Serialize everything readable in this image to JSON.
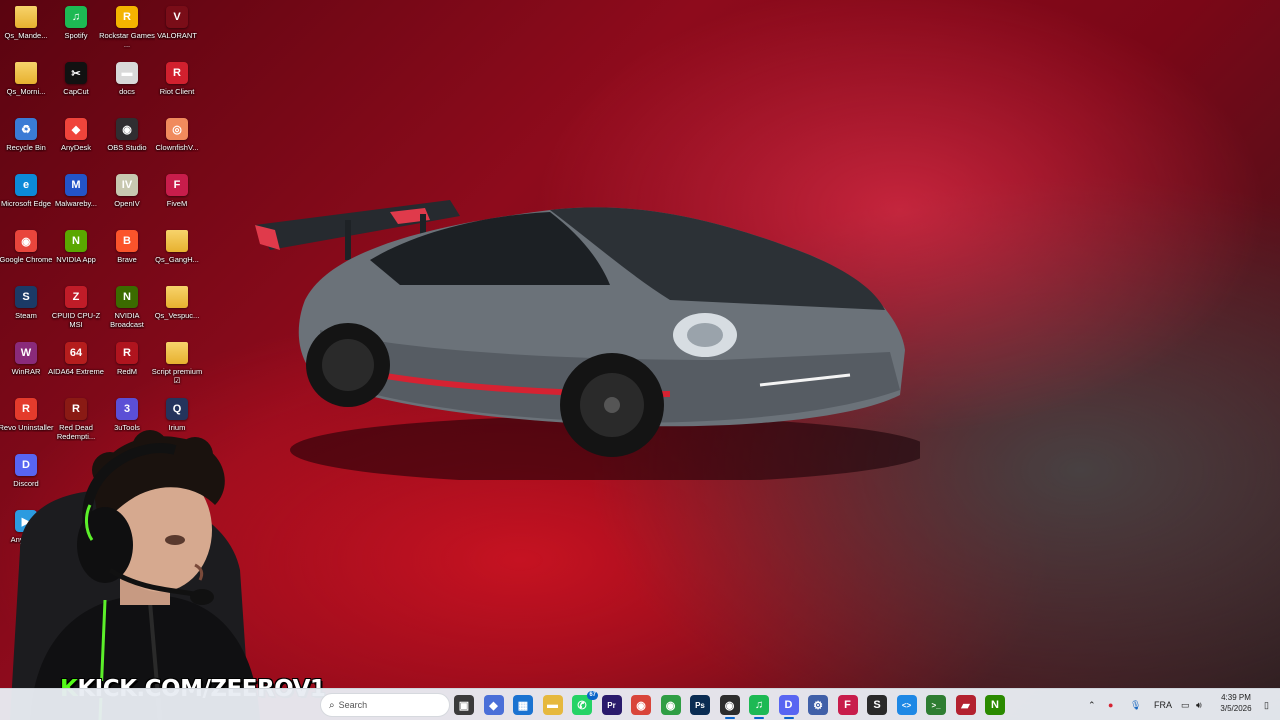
{
  "desktop": {
    "icons": [
      {
        "label": "Qs_Mande...",
        "glyph": "",
        "color": "#f2c84b",
        "folder": true
      },
      {
        "label": "Spotify",
        "glyph": "♫",
        "color": "#1db954"
      },
      {
        "label": "Rockstar Games ...",
        "glyph": "R",
        "color": "#f4b400"
      },
      {
        "label": "VALORANT",
        "glyph": "V",
        "color": "#7a0d18"
      },
      {
        "label": "Qs_Morni...",
        "glyph": "",
        "color": "#f2c84b",
        "folder": true
      },
      {
        "label": "CapCut",
        "glyph": "✂",
        "color": "#111111"
      },
      {
        "label": "docs",
        "glyph": "▬",
        "color": "#d9d9d9"
      },
      {
        "label": "Riot Client",
        "glyph": "R",
        "color": "#d1202e"
      },
      {
        "label": "Recycle Bin",
        "glyph": "♻",
        "color": "#3a7bd5"
      },
      {
        "label": "AnyDesk",
        "glyph": "◆",
        "color": "#ef443b"
      },
      {
        "label": "OBS Studio",
        "glyph": "◉",
        "color": "#302e31"
      },
      {
        "label": "ClownfishV...",
        "glyph": "◎",
        "color": "#f08a5d"
      },
      {
        "label": "Microsoft Edge",
        "glyph": "e",
        "color": "#0c8ad8"
      },
      {
        "label": "Malwareby...",
        "glyph": "M",
        "color": "#2354c8"
      },
      {
        "label": "OpenIV",
        "glyph": "IV",
        "color": "#c8c8b0"
      },
      {
        "label": "FiveM",
        "glyph": "F",
        "color": "#c81d4b"
      },
      {
        "label": "Google Chrome",
        "glyph": "◉",
        "color": "#e8453c"
      },
      {
        "label": "NVIDIA App",
        "glyph": "N",
        "color": "#5aa700"
      },
      {
        "label": "Brave",
        "glyph": "B",
        "color": "#fb542b"
      },
      {
        "label": "Qs_GangH...",
        "glyph": "",
        "color": "#f2c84b",
        "folder": true
      },
      {
        "label": "Steam",
        "glyph": "S",
        "color": "#1b3a66"
      },
      {
        "label": "CPUID CPU-Z MSI",
        "glyph": "Z",
        "color": "#c01c28"
      },
      {
        "label": "NVIDIA Broadcast",
        "glyph": "N",
        "color": "#3b6b00"
      },
      {
        "label": "Qs_Vespuc...",
        "glyph": "",
        "color": "#f2c84b",
        "folder": true
      },
      {
        "label": "WinRAR",
        "glyph": "W",
        "color": "#8a2a7a"
      },
      {
        "label": "AIDA64 Extreme",
        "glyph": "64",
        "color": "#b51d1d"
      },
      {
        "label": "RedM",
        "glyph": "R",
        "color": "#b0141e"
      },
      {
        "label": "Script premium ☑",
        "glyph": "",
        "color": "#f2c84b",
        "folder": true
      },
      {
        "label": "Revo Uninstaller",
        "glyph": "R",
        "color": "#e43b2c"
      },
      {
        "label": "Red Dead Redempti...",
        "glyph": "R",
        "color": "#8a1a14"
      },
      {
        "label": "3uTools",
        "glyph": "3",
        "color": "#5b4fd6"
      },
      {
        "label": "Irium",
        "glyph": "Q",
        "color": "#24345c"
      },
      {
        "label": "Discord",
        "glyph": "D",
        "color": "#5865f2"
      },
      {
        "label": "Any DVD",
        "glyph": "▶",
        "color": "#2c9be0"
      }
    ]
  },
  "overlay": {
    "kick_prefix": "K",
    "kick_text": "KICK.COM/ZEEROV1"
  },
  "taskbar": {
    "search_placeholder": "Search",
    "apps": [
      {
        "name": "task-view",
        "glyph": "▣",
        "color": "#3b3b3b"
      },
      {
        "name": "ethereum-app",
        "glyph": "◆",
        "color": "#4a6fd8"
      },
      {
        "name": "store",
        "glyph": "▦",
        "color": "#1b73d1"
      },
      {
        "name": "file-explorer",
        "glyph": "▬",
        "color": "#e6b83e"
      },
      {
        "name": "whatsapp",
        "glyph": "✆",
        "color": "#25d366",
        "badge": "67"
      },
      {
        "name": "premiere-pro",
        "glyph": "Pr",
        "color": "#2a1a6b"
      },
      {
        "name": "chrome",
        "glyph": "◉",
        "color": "#d9453a"
      },
      {
        "name": "chrome-alt",
        "glyph": "◉",
        "color": "#2f9e44"
      },
      {
        "name": "photoshop",
        "glyph": "Ps",
        "color": "#0a2c52"
      },
      {
        "name": "obs",
        "glyph": "◉",
        "color": "#2d2d2d",
        "active": true
      },
      {
        "name": "spotify",
        "glyph": "♫",
        "color": "#1db954",
        "active": true
      },
      {
        "name": "discord",
        "glyph": "D",
        "color": "#5865f2",
        "active": true
      },
      {
        "name": "network-tool",
        "glyph": "⚙",
        "color": "#4060a8"
      },
      {
        "name": "fivem",
        "glyph": "F",
        "color": "#c81d4b"
      },
      {
        "name": "steam",
        "glyph": "S",
        "color": "#2a2a2a"
      },
      {
        "name": "vscode",
        "glyph": "<>",
        "color": "#1e88e5"
      },
      {
        "name": "terminal",
        "glyph": ">_",
        "color": "#2e7d32"
      },
      {
        "name": "streamlabs",
        "glyph": "▰",
        "color": "#b3212f"
      },
      {
        "name": "nvidia",
        "glyph": "N",
        "color": "#2b8a00"
      }
    ],
    "tray": {
      "language": "FRA",
      "time": "4:39 PM",
      "date": "3/5/2026"
    }
  }
}
